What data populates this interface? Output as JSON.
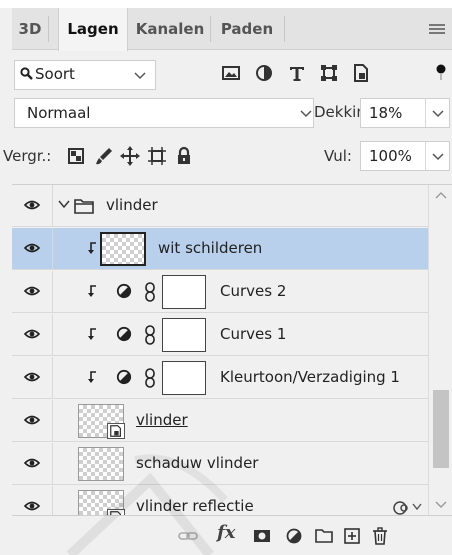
{
  "tabs": [
    {
      "label": "3D",
      "active": false
    },
    {
      "label": "Lagen",
      "active": true
    },
    {
      "label": "Kanalen",
      "active": false
    },
    {
      "label": "Paden",
      "active": false
    }
  ],
  "filter": {
    "label": "Soort",
    "icons": [
      "pixel-layer-filter-icon",
      "adjustment-layer-filter-icon",
      "type-layer-filter-icon",
      "shape-layer-filter-icon",
      "smart-object-filter-icon"
    ]
  },
  "blend": {
    "mode": "Normaal",
    "opacity_label": "Dekking:",
    "opacity_value": "18%"
  },
  "lock": {
    "label": "Vergr.:",
    "icons": [
      "lock-transparent-pixels-icon",
      "lock-image-pixels-icon",
      "lock-position-icon",
      "lock-artboard-icon",
      "lock-all-icon"
    ],
    "fill_label": "Vul:",
    "fill_value": "100%"
  },
  "layers": [
    {
      "name": "vlinder",
      "kind": "group",
      "expanded": true,
      "visible": true,
      "selected": false
    },
    {
      "name": "wit schilderen",
      "kind": "pixel",
      "clipped": true,
      "visible": true,
      "selected": true
    },
    {
      "name": "Curves 2",
      "kind": "adjustment",
      "clipped": true,
      "visible": true,
      "selected": false
    },
    {
      "name": "Curves 1",
      "kind": "adjustment",
      "clipped": true,
      "visible": true,
      "selected": false
    },
    {
      "name": "Kleurtoon/Verzadiging 1",
      "kind": "adjustment",
      "clipped": true,
      "visible": true,
      "selected": false
    },
    {
      "name": "vlinder",
      "kind": "smart-object",
      "clipping_base": true,
      "visible": true,
      "selected": false
    },
    {
      "name": "schaduw vlinder",
      "kind": "pixel",
      "visible": true,
      "selected": false
    },
    {
      "name": "vlinder reflectie",
      "kind": "smart-object",
      "has_effects": true,
      "visible": true,
      "selected": false
    }
  ],
  "bottom_bar": {
    "icons": [
      "link-layers-icon",
      "layer-style-fx-icon",
      "add-mask-icon",
      "new-adjustment-layer-icon",
      "new-group-icon",
      "new-layer-icon",
      "delete-layer-icon"
    ],
    "fx_label": "fx"
  },
  "colors": {
    "selected_row": "#b9d0ec",
    "panel_bg": "#f0f0f0",
    "tab_bg": "#e3e3e3"
  }
}
